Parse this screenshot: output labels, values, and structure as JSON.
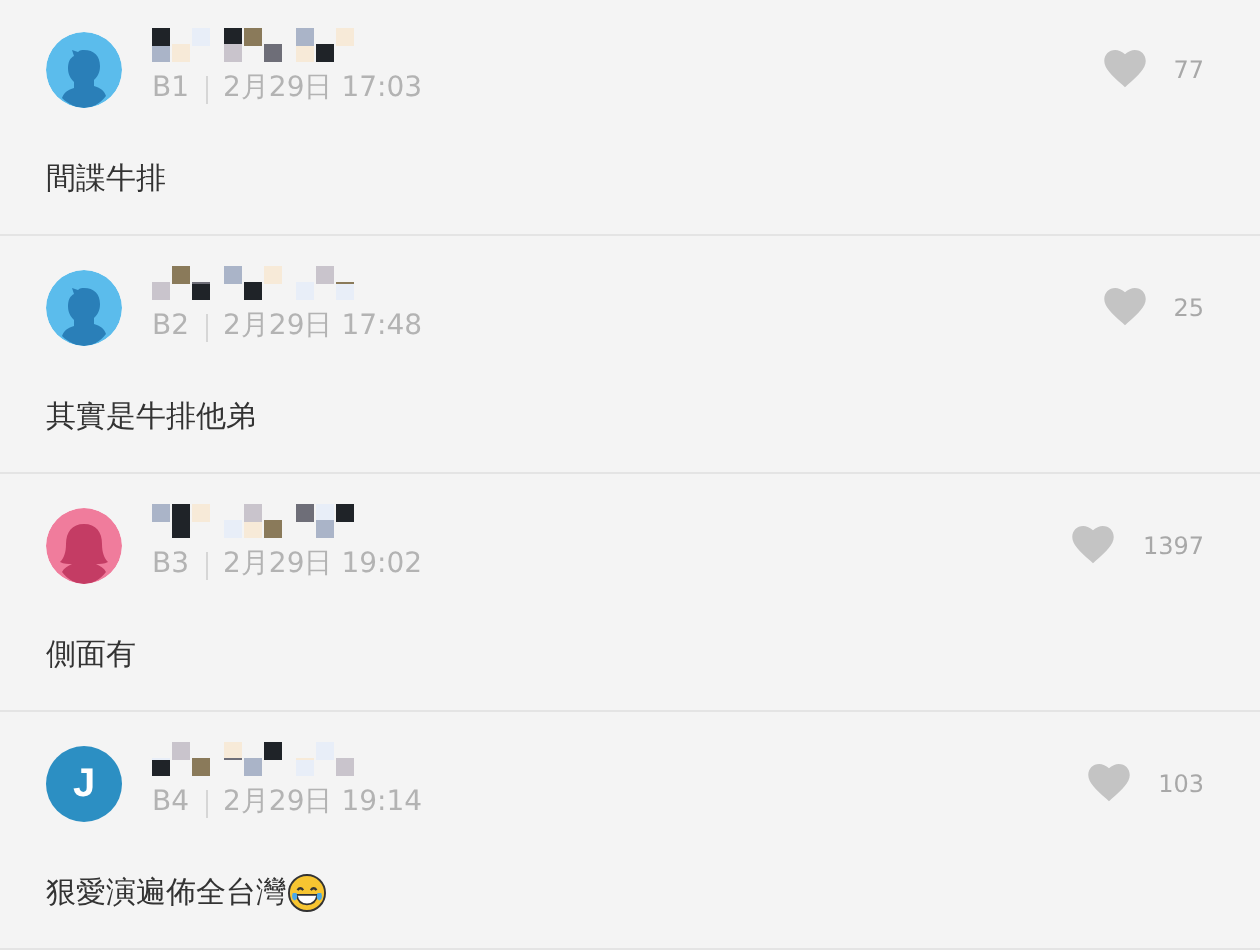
{
  "comments": [
    {
      "avatar": {
        "kind": "boy",
        "color": "#5bbcec"
      },
      "floor": "B1",
      "time": "2月29日 17:03",
      "likes": "77",
      "text": "間諜牛排",
      "trailing_emoji": false
    },
    {
      "avatar": {
        "kind": "boy",
        "color": "#5bbcec"
      },
      "floor": "B2",
      "time": "2月29日 17:48",
      "likes": "25",
      "text": "其實是牛排他弟",
      "trailing_emoji": false
    },
    {
      "avatar": {
        "kind": "girl",
        "color": "#f07c9c"
      },
      "floor": "B3",
      "time": "2月29日 19:02",
      "likes": "1397",
      "text": "側面有",
      "trailing_emoji": false
    },
    {
      "avatar": {
        "kind": "initial",
        "color": "#2c8fc3",
        "letter": "J"
      },
      "floor": "B4",
      "time": "2月29日 19:14",
      "likes": "103",
      "text": "狠愛演遍佈全台灣",
      "trailing_emoji": true
    }
  ]
}
